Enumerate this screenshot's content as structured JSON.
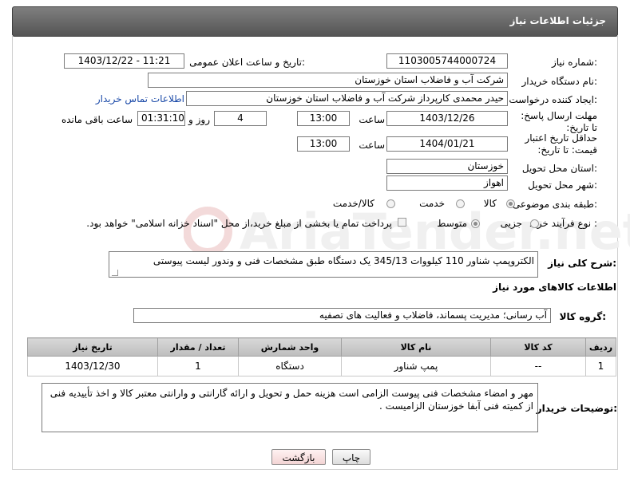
{
  "header": {
    "title": "جزئیات اطلاعات نیاز"
  },
  "fields": {
    "need_number_label": "شماره نیاز:",
    "need_number": "1103005744000724",
    "announce_label": "تاریخ و ساعت اعلان عمومی:",
    "announce_value": "1403/12/22 - 11:21",
    "buyer_org_label": "نام دستگاه خریدار:",
    "buyer_org": "شرکت آب و فاضلاب استان خوزستان",
    "creator_label": "ایجاد کننده درخواست:",
    "creator": "حیدر محمدی کارپرداز شرکت آب و فاضلاب استان خوزستان",
    "contact_link": "اطلاعات تماس خریدار",
    "reply_deadline_label": "مهلت ارسال پاسخ: تا تاریخ:",
    "reply_date": "1403/12/26",
    "hour_label": "ساعت",
    "reply_time": "13:00",
    "days_value": "4",
    "days_label": "روز و",
    "remaining_time": "01:31:10",
    "remaining_label": "ساعت باقی مانده",
    "price_validity_label": "حداقل تاریخ اعتبار قیمت: تا تاریخ:",
    "price_date": "1404/01/21",
    "price_time": "13:00",
    "province_label": "استان محل تحویل:",
    "province": "خوزستان",
    "city_label": "شهر محل تحویل:",
    "city": "اهواز",
    "category_label": "طبقه بندی موضوعی:",
    "category_options": [
      "کالا",
      "خدمت",
      "کالا/خدمت"
    ],
    "process_label": "نوع فرآیند خرید :",
    "process_options": [
      "جزیی",
      "متوسط"
    ],
    "payment_note": "پرداخت تمام یا بخشی از مبلغ خرید،از محل \"اسناد خزانه اسلامی\" خواهد بود."
  },
  "description": {
    "label": "شرح کلی نیاز:",
    "text": "الکتروپمپ شناور 110 کیلووات 345/13 یک دستگاه طبق مشخصات فنی و وندور لیست پیوستی"
  },
  "goods": {
    "section_title": "اطلاعات کالاهای مورد نیاز",
    "group_label": "گروه کالا:",
    "group_value": "آب رسانی؛ مدیریت پسماند، فاضلاب و فعالیت های تصفیه",
    "columns": [
      "ردیف",
      "کد کالا",
      "نام کالا",
      "واحد شمارش",
      "تعداد / مقدار",
      "تاریخ نیاز"
    ],
    "rows": [
      {
        "row": "1",
        "code": "--",
        "name": "پمپ شناور",
        "unit": "دستگاه",
        "qty": "1",
        "date": "1403/12/30"
      }
    ]
  },
  "buyer_notes": {
    "label": "توضیحات خریدار:",
    "text": "مهر و امضاء مشخصات فنی پیوست الزامی است  هزینه حمل و تحویل و ارائه گارانتی و وارانتی معتبر کالا و اخذ تأییدیه فنی از کمیته فنی آبفا خوزستان الزامیست ."
  },
  "buttons": {
    "print": "چاپ",
    "back": "بازگشت"
  },
  "colors": {
    "header_bg": "#6a6a6a",
    "link": "#1b4aa8",
    "back_button_bg": "#fbe3e3"
  }
}
